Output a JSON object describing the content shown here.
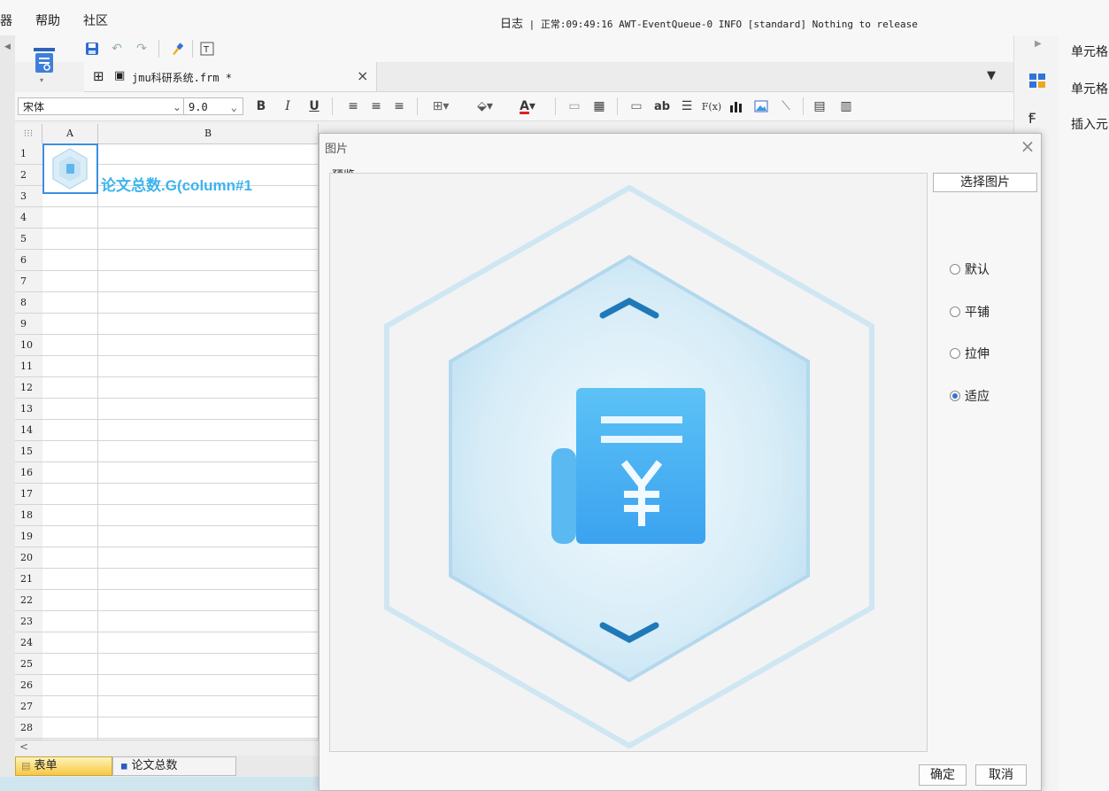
{
  "menubar": {
    "items": [
      {
        "label": "器"
      },
      {
        "label": "帮助"
      },
      {
        "label": "社区"
      }
    ],
    "log_label": "日志",
    "log_text": "| 正常:09:49:16 AWT-EventQueue-0 INFO [standard] Nothing to release"
  },
  "tabs": {
    "document": "jmu科研系统.frm *",
    "close": "×"
  },
  "format": {
    "font_name": "宋体",
    "font_size": "9.0",
    "bold": "B",
    "italic": "I",
    "underline": "U",
    "text_style": "ab",
    "formula": "F(x)"
  },
  "grid": {
    "corner": "⁝⁝⁝",
    "columns": [
      "A",
      "B"
    ],
    "rows": [
      "1",
      "2",
      "3",
      "4",
      "5",
      "6",
      "7",
      "8",
      "9",
      "10",
      "11",
      "12",
      "13",
      "14",
      "15",
      "16",
      "17",
      "18",
      "19",
      "20",
      "21",
      "22",
      "23",
      "24",
      "25",
      "26",
      "27",
      "28"
    ],
    "cell_b2": "论文总数.G(column#1",
    "scroll_left": "<"
  },
  "sheets": {
    "form_tab": "表单",
    "papers_tab": "论文总数"
  },
  "right_panel": {
    "items": [
      "单元格",
      "单元格",
      "插入元"
    ]
  },
  "dialog": {
    "title": "图片",
    "close": "×",
    "preview_label": "预览",
    "choose_button": "选择图片",
    "options": [
      {
        "label": "默认",
        "selected": false
      },
      {
        "label": "平铺",
        "selected": false
      },
      {
        "label": "拉伸",
        "selected": false
      },
      {
        "label": "适应",
        "selected": true
      }
    ],
    "ok_button": "确定",
    "cancel_button": "取消"
  },
  "colors": {
    "accent": "#3b8fe6",
    "cell_text": "#3cb4ee",
    "icon_blue": "#43a9f2"
  }
}
